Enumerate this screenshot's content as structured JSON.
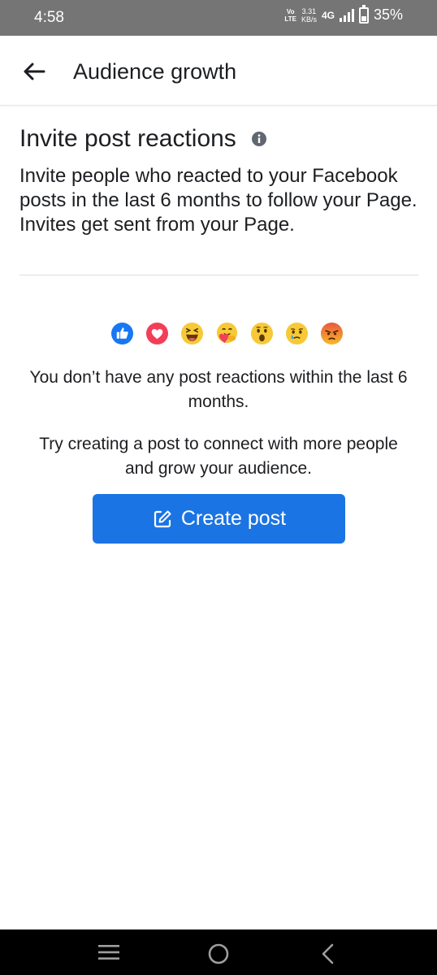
{
  "status_bar": {
    "time": "4:58",
    "volte_top": "Vo",
    "volte_bottom": "LTE",
    "speed_value": "3.31",
    "speed_unit": "KB/s",
    "network": "4G",
    "battery": "35%"
  },
  "header": {
    "title": "Audience growth"
  },
  "section": {
    "title": "Invite post reactions",
    "description": "Invite people who reacted to your Facebook posts in the last 6 months to follow your Page. Invites get sent from your Page."
  },
  "reactions": [
    "like-reaction-icon",
    "love-reaction-icon",
    "haha-reaction-icon",
    "care-reaction-icon",
    "wow-reaction-icon",
    "sad-reaction-icon",
    "angry-reaction-icon"
  ],
  "empty_state": {
    "title": "You don’t have any post reactions within the last 6 months.",
    "description": "Try creating a post to connect with more people and grow your audience.",
    "button_label": "Create post"
  },
  "colors": {
    "accent": "#1b74e4",
    "status_bar": "#757575",
    "nav_bar": "#000000"
  }
}
